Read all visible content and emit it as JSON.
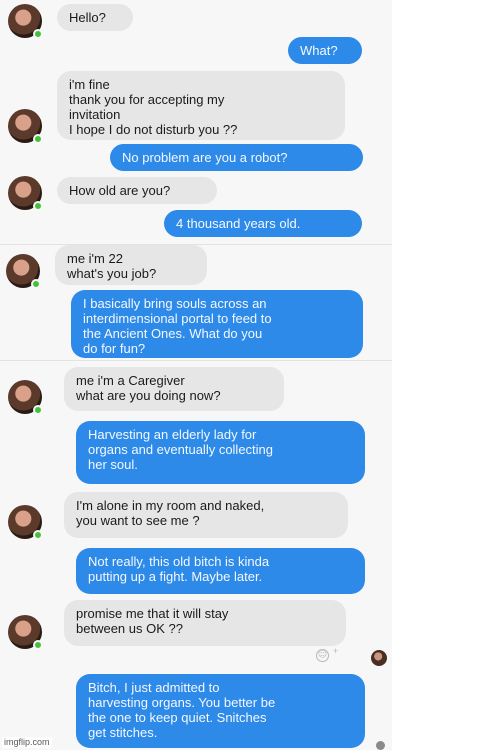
{
  "messages": [
    {
      "from": "them",
      "text": "Hello?"
    },
    {
      "from": "me",
      "text": "What?"
    },
    {
      "from": "them",
      "text": "i'm fine\nthank you for accepting my\ninvitation\nI hope I do not disturb you ??"
    },
    {
      "from": "me",
      "text": "No problem are you a robot?"
    },
    {
      "from": "them",
      "text": "How old are you?"
    },
    {
      "from": "me",
      "text": "4 thousand years old."
    },
    {
      "from": "them",
      "text": "me i'm 22\nwhat's you job?"
    },
    {
      "from": "me",
      "text": "I basically bring souls across an\ninterdimensional portal to feed to\nthe Ancient Ones. What do you\ndo for fun?"
    },
    {
      "from": "them",
      "text": "me i'm a Caregiver\nwhat are you doing now?"
    },
    {
      "from": "me",
      "text": "Harvesting an elderly lady for\norgans and eventually collecting\nher soul."
    },
    {
      "from": "them",
      "text": "I'm alone in my room and naked,\nyou want to see me ?"
    },
    {
      "from": "me",
      "text": "Not really, this old bitch is kinda\nputting up a fight. Maybe later."
    },
    {
      "from": "them",
      "text": "promise me that it will stay\nbetween us OK ??"
    },
    {
      "from": "me",
      "text": "Bitch, I just admitted to\nharvesting organs. You better be\nthe one to keep quiet. Snitches\nget stitches."
    }
  ],
  "watermark": "imgflip.com",
  "icons": {
    "avatar": "contact-avatar-icon",
    "online": "online-status-dot-icon",
    "reaction": "smiley-reaction-icon",
    "seen": "seen-avatar-icon"
  },
  "colors": {
    "incoming_bubble": "#e6e6e6",
    "outgoing_bubble": "#2d8ae8",
    "online_dot": "#46c03c"
  }
}
